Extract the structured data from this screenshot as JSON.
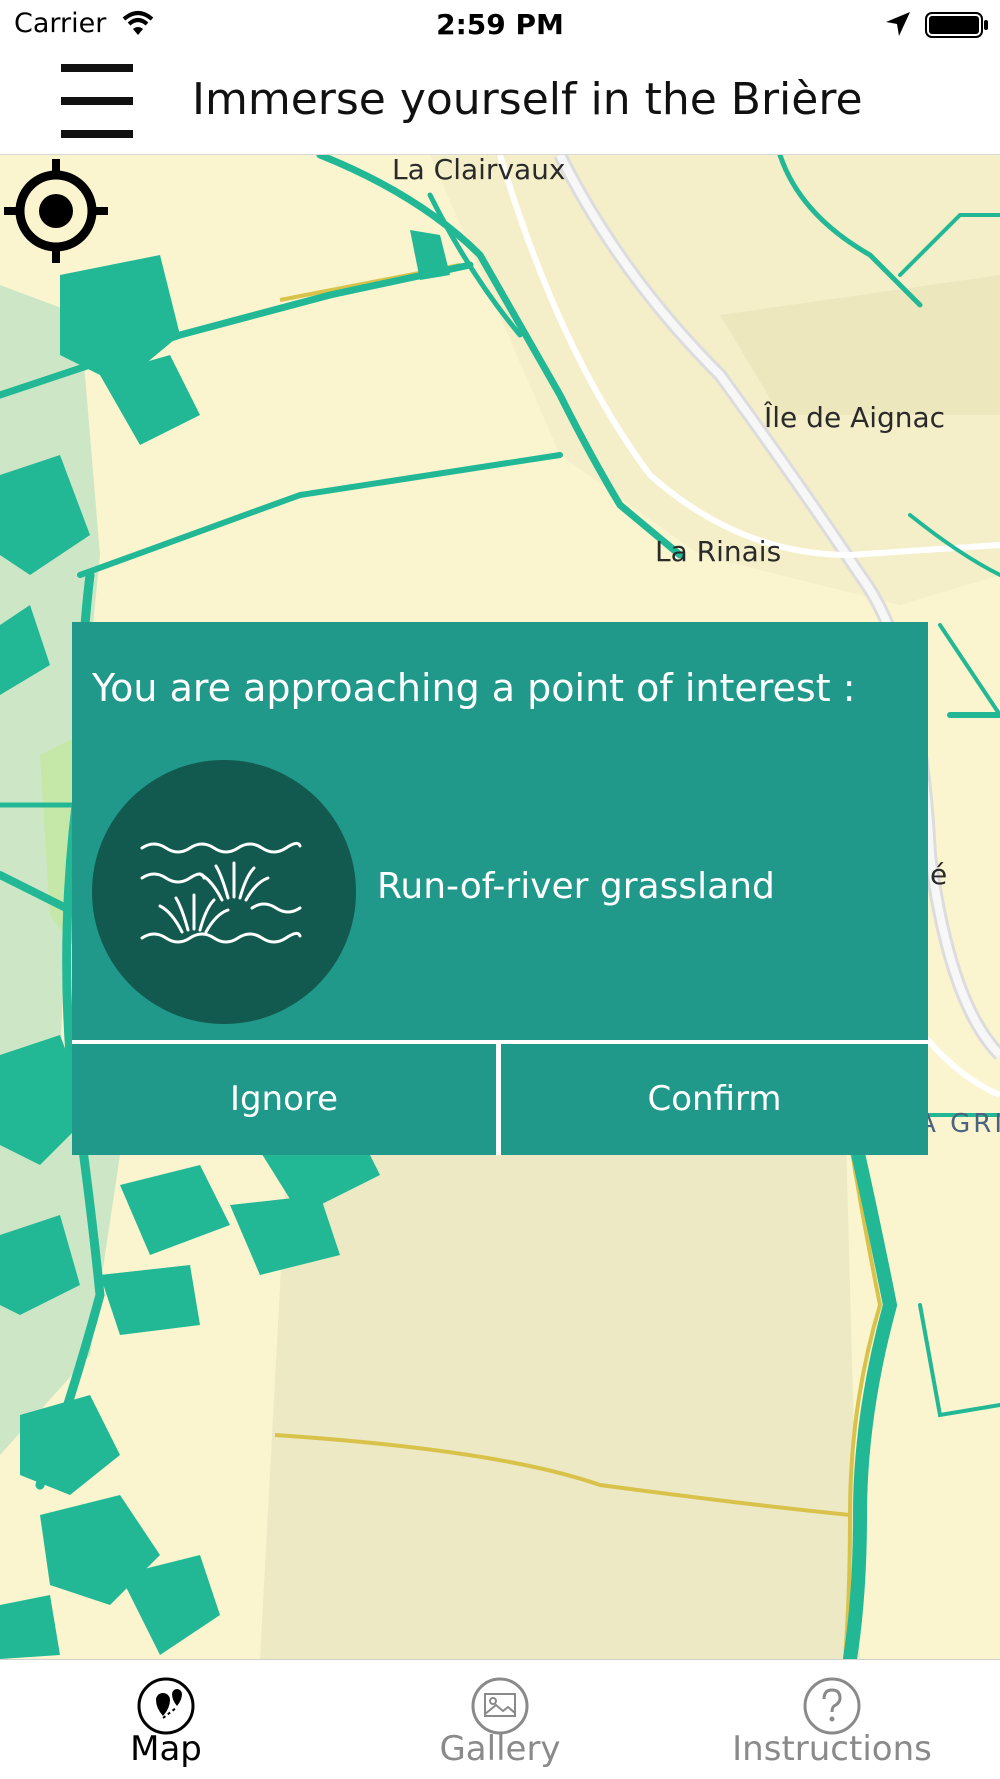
{
  "status_bar": {
    "carrier": "Carrier",
    "time": "2:59 PM"
  },
  "header": {
    "title": "Immerse yourself in the Brière",
    "menu_icon": "hamburger-menu-icon"
  },
  "map": {
    "labels": [
      "La Clairvaux",
      "Île de Aignac",
      "La Rinais",
      "LA GRI",
      "é"
    ],
    "colors": {
      "land": "#faf5cf",
      "water": "#22b896",
      "marsh": "#cfe8c8",
      "road": "#dcdcdc",
      "path": "#d9c24a"
    },
    "locate_icon": "crosshair-locate-icon"
  },
  "dialog": {
    "message": "You are approaching a point of interest :",
    "poi_name": "Run-of-river grassland",
    "poi_icon": "grassland-water-icon",
    "ignore_label": "Ignore",
    "confirm_label": "Confirm",
    "colors": {
      "background": "#20998a",
      "icon_circle": "#12594f"
    }
  },
  "tab_bar": {
    "tabs": [
      {
        "label": "Map",
        "icon": "map-pin-icon",
        "active": true
      },
      {
        "label": "Gallery",
        "icon": "gallery-icon",
        "active": false
      },
      {
        "label": "Instructions",
        "icon": "question-icon",
        "active": false
      }
    ]
  }
}
